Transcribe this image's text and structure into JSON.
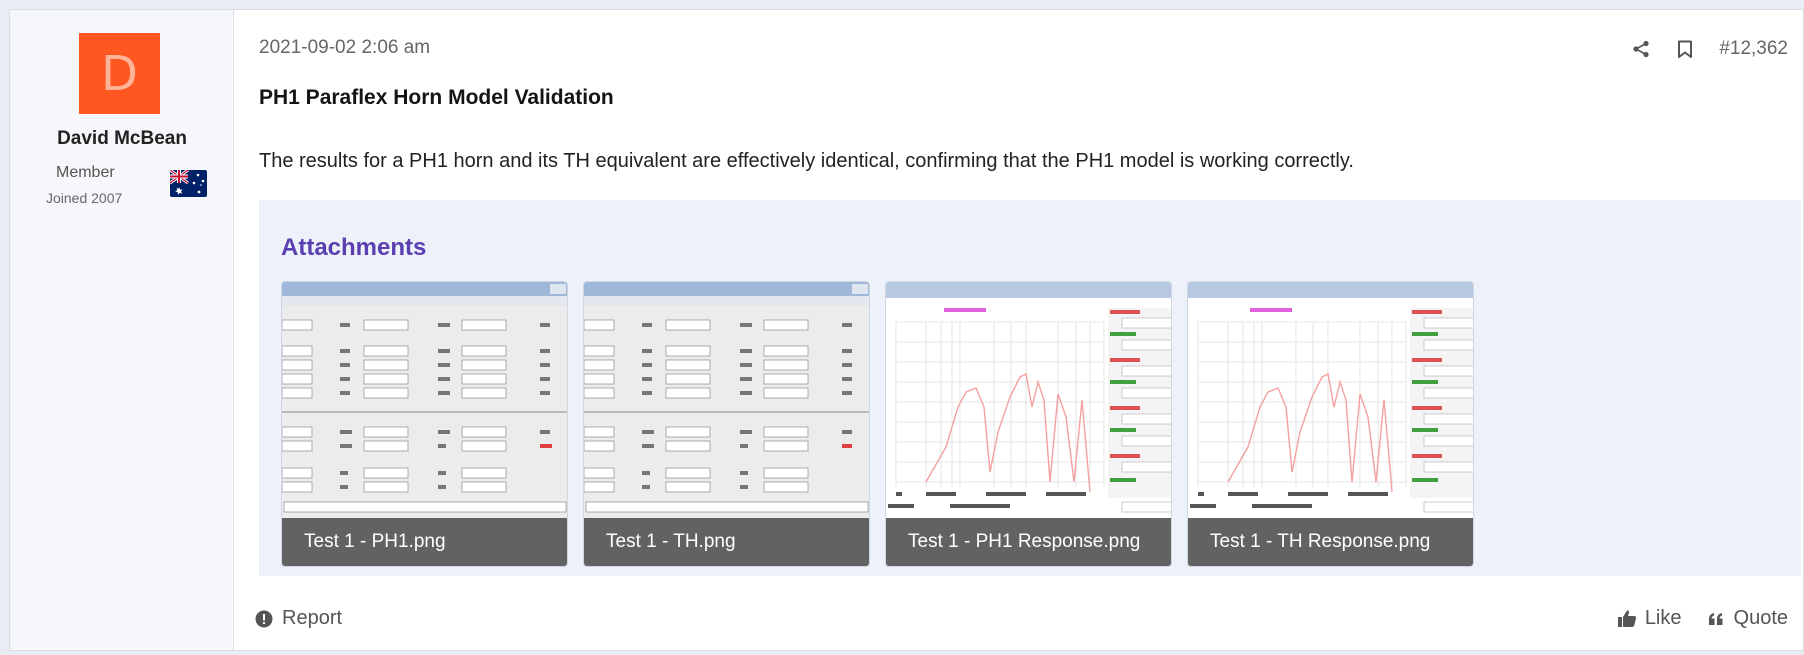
{
  "user": {
    "avatar_letter": "D",
    "avatar_color": "#ff5722",
    "name": "David McBean",
    "title": "Member",
    "joined": "Joined 2007",
    "flag_icon": "australia-flag-icon"
  },
  "post": {
    "date": "2021-09-02 2:06 am",
    "number": "#12,362",
    "title": "PH1 Paraflex Horn Model Validation",
    "body": "The results for a PH1 horn and its TH equivalent are effectively identical, confirming that the PH1 model is working correctly."
  },
  "header_icons": [
    "share-icon",
    "bookmark-icon"
  ],
  "attachments": {
    "heading": "Attachments",
    "items": [
      {
        "label": "Test 1 - PH1.png",
        "kind": "input-parameters"
      },
      {
        "label": "Test 1 - TH.png",
        "kind": "input-parameters"
      },
      {
        "label": "Test 1 - PH1 Response.png",
        "kind": "response"
      },
      {
        "label": "Test 1 - TH Response.png",
        "kind": "response"
      }
    ]
  },
  "footer": {
    "report": "Report",
    "like": "Like",
    "quote": "Quote"
  },
  "colors": {
    "heading_accent": "#5b3fb0",
    "attachments_bg": "#edf1fa",
    "caption_bg": "#555555"
  }
}
